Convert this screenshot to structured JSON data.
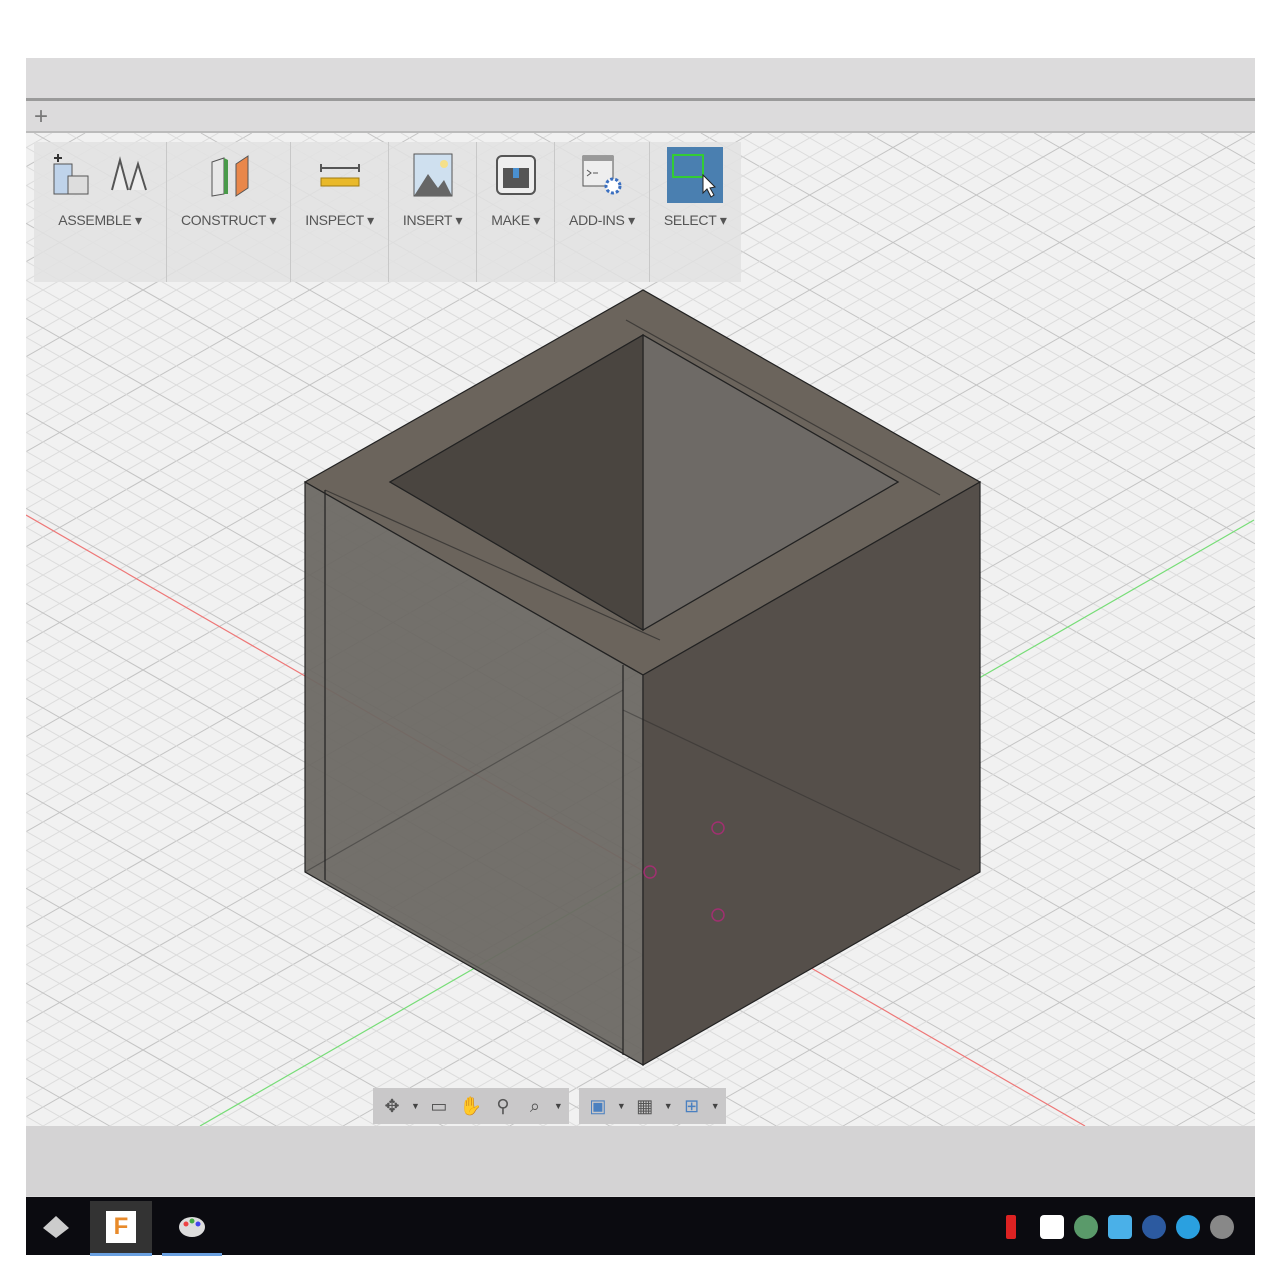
{
  "tabbar": {
    "new_tab": "+"
  },
  "toolbar": {
    "groups": [
      {
        "label": "ASSEMBLE ▾"
      },
      {
        "label": "CONSTRUCT ▾"
      },
      {
        "label": "INSPECT ▾"
      },
      {
        "label": "INSERT ▾"
      },
      {
        "label": "MAKE ▾"
      },
      {
        "label": "ADD-INS ▾"
      },
      {
        "label": "SELECT ▾"
      }
    ]
  },
  "colors": {
    "select_active": "#4a7fb0",
    "cube_body": "#5e5852",
    "x_axis": "#e06060",
    "y_axis": "#60d060",
    "grid": "#c8c8c8"
  },
  "navbar": {
    "icons": [
      "orbit-icon",
      "look-at-icon",
      "pan-icon",
      "zoom-icon",
      "fit-icon",
      "display-settings-icon",
      "grid-icon",
      "viewports-icon"
    ]
  },
  "taskbar": {
    "apps": [
      "start",
      "fusion-360",
      "paint"
    ],
    "fusion_letter": "F"
  }
}
